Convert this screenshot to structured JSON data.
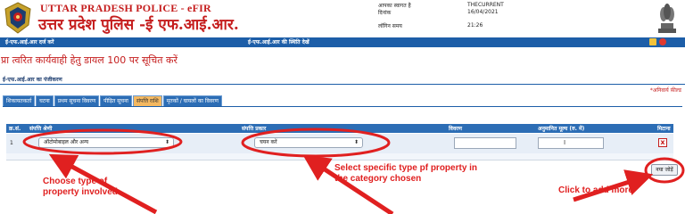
{
  "header": {
    "title": "UTTAR PRADESH POLICE - eFIR",
    "subtitle": "उत्तर प्रदेश पुलिस -ई एफ.आई.आर.",
    "welcome_label": "आपका स्वागत है",
    "welcome_value": "THECURRENT",
    "date_label": "दिनांक",
    "date_value": "16/04/2021",
    "login_label": "लॉगिन समय",
    "login_value": "21:26"
  },
  "nav": {
    "item1": "ई-एफ.आई.आर दर्ज करें",
    "item2": "ई-एफ.आई.आर की स्थिति देखें",
    "icons": [
      "home-icon",
      "power-icon"
    ]
  },
  "notice": "प्रा त्वरित कार्यवाही हेतु डायल 100 पर सूचित करें",
  "section_title": "ई-एफ.आई.आर का पंजीकरण",
  "mandatory_note": "*अनिवार्य फ़ील्ड",
  "tabs": [
    {
      "label": "शिकायतकर्ता"
    },
    {
      "label": "घटना"
    },
    {
      "label": "प्रथम सूचना विवरण"
    },
    {
      "label": "पीड़ित सूचना"
    },
    {
      "label": "संपत्ति राशि",
      "active": true
    },
    {
      "label": "मृतकों / घायलों का विवरण"
    }
  ],
  "table": {
    "headers": [
      "क्र.सं.",
      "संपत्ति श्रेणी",
      "संपत्ति प्रकार",
      "विवरण",
      "अनुमानित मूल्य (रु. में)",
      "मिटाना"
    ],
    "row": {
      "serial": "1",
      "category": "ऑटोमोबाइल और अन्य",
      "type": "चयन करें",
      "description": "",
      "value": ""
    },
    "delete_label": "x",
    "add_label": "नया जोड़ें"
  },
  "annotations": {
    "category": "Choose type of\nproperty involved",
    "type": "Select specific type pf property in\nthe category chosen",
    "add": "Click to add more"
  },
  "colors": {
    "brand_red": "#c51d1d",
    "nav_blue": "#1d5ea8",
    "annotation_red": "#e02020",
    "active_tab": "#f4b860"
  }
}
